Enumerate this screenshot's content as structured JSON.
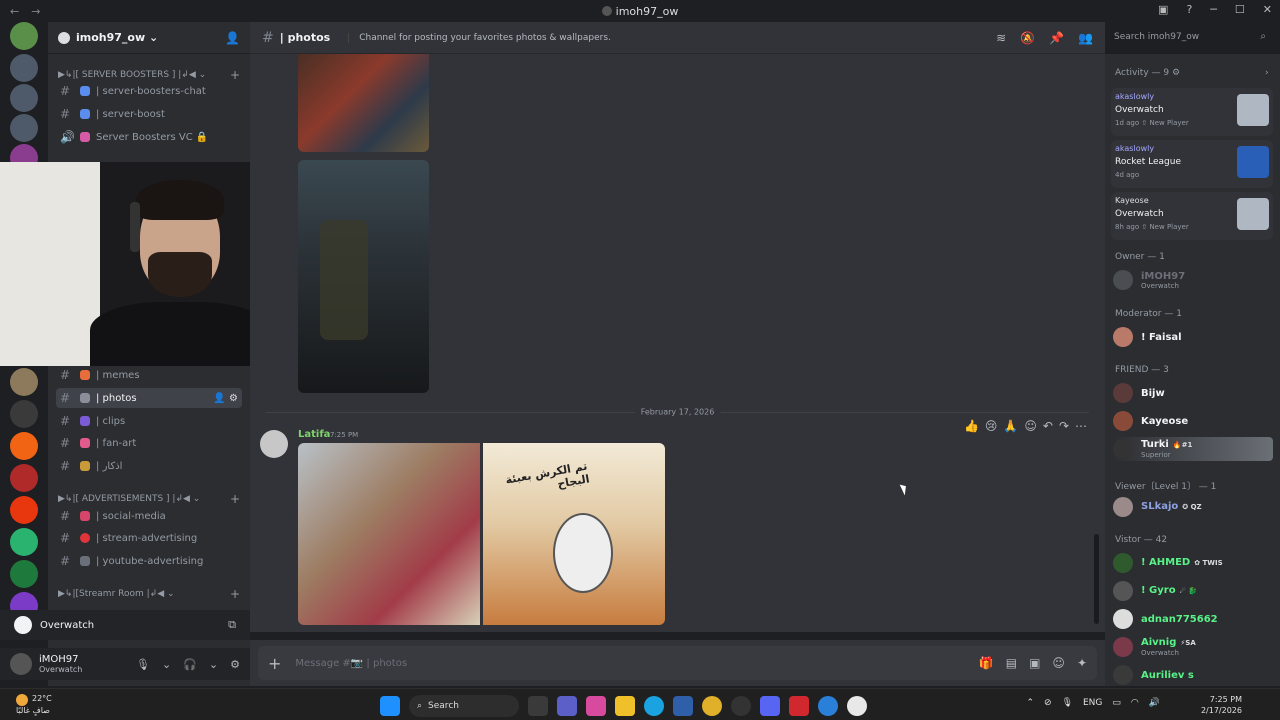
{
  "window": {
    "title": "imoh97_ow"
  },
  "server": {
    "name": "imoh97_ow"
  },
  "channels": {
    "cat_boosters": "▶↳|[ SERVER BOOSTERS ] |↲◀",
    "boosters_chat": "| server-boosters-chat",
    "boost": "| server-boost",
    "boost_vc": "Server Boosters VC 🔒",
    "memes": "| memes",
    "photos": "| photos",
    "clips": "| clips",
    "fanart": "| fan-art",
    "azkar": "| اذكار",
    "cat_ads": "▶↳|[ ADVERTISEMENTS ] |↲◀",
    "social": "| social-media",
    "stream_ads": "| stream-advertising",
    "yt_ads": "| youtube-advertising",
    "cat_stream": "▶↳|[Streamr Room |↲◀"
  },
  "voice": {
    "game": "Overwatch"
  },
  "user": {
    "name": "iMOH97",
    "status": "Overwatch"
  },
  "header": {
    "channel": "| photos",
    "topic": "Channel for posting your favorites photos & wallpapers.",
    "search_placeholder": "Search imoh97_ow"
  },
  "chat": {
    "date_divider": "February 17, 2026",
    "message": {
      "author": "Latifa",
      "time": "7:25 PM",
      "meme_caption": "تم الكرش بعبئة البجاح"
    }
  },
  "composer": {
    "placeholder": "Message #📷 | photos"
  },
  "members": {
    "activity_label": "Activity — 9 ⚙",
    "activities": [
      {
        "user": "akaslowly",
        "game": "Overwatch",
        "meta": "1d ago  ⇧ New Player"
      },
      {
        "user": "akaslowly",
        "game": "Rocket League",
        "meta": "4d ago"
      },
      {
        "user": "Kayeose",
        "game": "Overwatch",
        "meta": "8h ago  ⇧ New Player"
      }
    ],
    "owner_label": "Owner — 1",
    "owner": {
      "name": "iMOH97",
      "sub": "Overwatch"
    },
    "mod_label": "Moderator — 1",
    "mod": {
      "name": "! Faisal"
    },
    "friend_label": "FRIEND — 3",
    "friends": [
      {
        "name": "Bijw"
      },
      {
        "name": "Kayeose"
      },
      {
        "name": "Turki",
        "badge": "🔥#1",
        "sub": "Superior"
      }
    ],
    "viewer_label": "Viewer〔Level 1〕 — 1",
    "viewer": {
      "name": "SLkajo",
      "badge": "✪ QZ"
    },
    "vistor_label": "Vistor — 42",
    "vistors": [
      {
        "name": "! AHMED",
        "badge": "✿ TWIS"
      },
      {
        "name": "! Gyro",
        "badge": "☄ 🐉"
      },
      {
        "name": "adnan775662"
      },
      {
        "name": "Aivnig",
        "badge": "⚡SA",
        "sub": "Overwatch"
      },
      {
        "name": "Auriliev s"
      }
    ]
  },
  "taskbar": {
    "temp": "22°C",
    "weather": "صافٍ غالبًا",
    "search": "Search",
    "lang": "ENG",
    "time": "7:25 PM",
    "date": "2/17/2026"
  },
  "colors": {
    "author_green": "#7fd36b",
    "member_green": "#58f287",
    "member_gold": "#f2f3f5"
  }
}
